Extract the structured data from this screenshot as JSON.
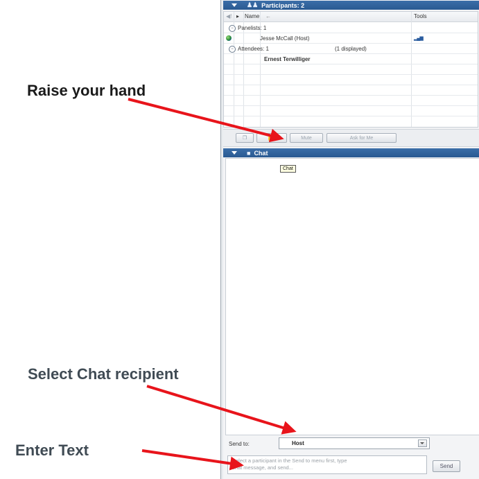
{
  "participants_panel": {
    "title": "Participants: 2",
    "columns": {
      "name": "Name",
      "tools": "Tools"
    },
    "panelists_group": "Panelists: 1",
    "host_row": {
      "name": "Jesse McCall (Host)"
    },
    "attendees_group": "Attendees: 1",
    "attendees_count": "(1 displayed)",
    "attendee_row": {
      "name": "Ernest Terwilliger"
    },
    "toolbar": {
      "mute_label": "Mute",
      "ask_label": "Ask for Me"
    }
  },
  "chat_panel": {
    "title": "Chat",
    "tooltip": "Chat",
    "send_to_label": "Send to:",
    "send_to_value": "Host",
    "message_placeholder_line1": "Select a participant in the Send to menu first, type",
    "message_placeholder_line2": "chat message, and send...",
    "send_label": "Send"
  },
  "annotations": {
    "raise_hand": "Raise your hand",
    "select_recipient": "Select Chat recipient",
    "enter_text": "Enter Text"
  },
  "colors": {
    "header_blue": "#2f6099",
    "arrow_red": "#e8141b"
  },
  "icons": [
    "participants-icon",
    "chat-bubble-icon",
    "globe-icon",
    "signal-icon",
    "raise-hand-icon",
    "collapse-icon"
  ]
}
